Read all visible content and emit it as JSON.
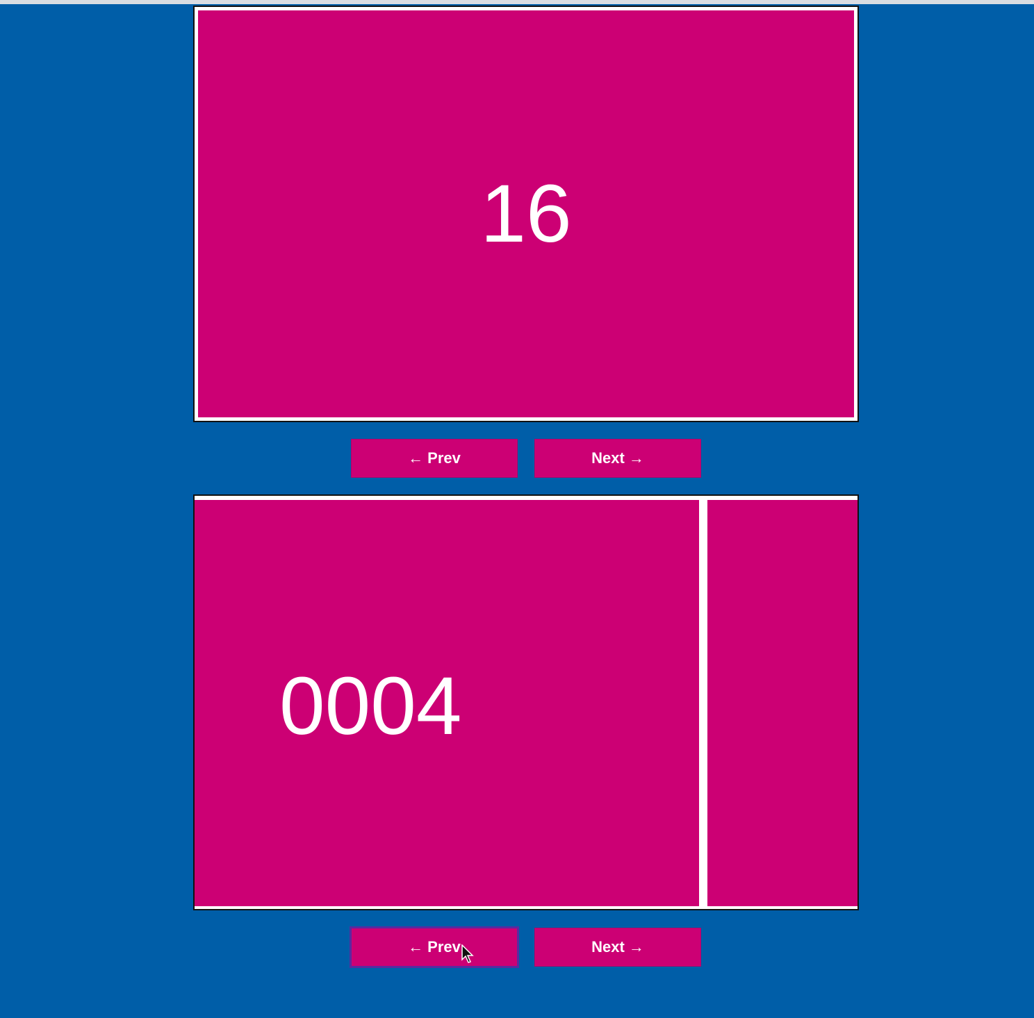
{
  "colors": {
    "background": "#005ea8",
    "slide": "#cc0074",
    "text": "#ffffff",
    "border": "#ffffff"
  },
  "carousel_top": {
    "current_slide": "16",
    "prev_label": "Prev",
    "next_label": "Next",
    "prev_icon": "arrow-left-icon",
    "next_icon": "arrow-right-icon"
  },
  "carousel_bottom": {
    "current_slide": "0004",
    "prev_label": "Prev",
    "next_label": "Next",
    "prev_icon": "arrow-left-icon",
    "next_icon": "arrow-right-icon",
    "focused_button": "prev"
  }
}
